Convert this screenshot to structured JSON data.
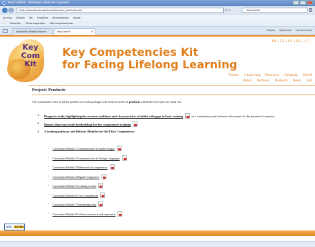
{
  "browser": {
    "window_title": "KeyComKit - Windows Internet Explorer",
    "url": "http://www.keycompetenceskit.eu/en_products.html",
    "search_value": "KeyComKit",
    "menu": [
      "Archivo",
      "Edición",
      "Ver",
      "Favoritos",
      "Herramientas",
      "Ayuda"
    ],
    "favorites_bar": [
      "Favoritos",
      "Sitios sugeridos",
      "Más complementos"
    ],
    "tabs": [
      {
        "label": "Foroductiv Metal Informe"
      },
      {
        "label": "KeyComKit"
      }
    ],
    "command_bar": [
      "Página",
      "Seguridad",
      "Herramientas"
    ]
  },
  "site": {
    "logo_line1": "Key",
    "logo_line2": "Com",
    "logo_line3": "Kit",
    "title_line1": "Key Competencies Kit",
    "title_line2": "for Facing Lifelong Learning",
    "languages": "EN | ES | DE | BG | LT |",
    "nav_primary": [
      "Project",
      "e-Learning",
      "Resource",
      "Contacts",
      "Site M"
    ],
    "nav_secondary": [
      "About",
      "Partners",
      "Products",
      "News",
      "Gall"
    ]
  },
  "page": {
    "title": "Project: Products",
    "intro_before": "The coordinated work of all the partners on work packages will result in series of ",
    "intro_bold": "products",
    "intro_after": " within the next ones are stand out:",
    "items": [
      {
        "num": "1.",
        "link": "Diagnosis study, highlighting the current conditions and characteristics of adults with gaps in basic training",
        "tail": ", as a consultancy and reference document for the partnered countries."
      },
      {
        "num": "2.",
        "link": "Report about successful methodology for key competences training",
        "tail": ""
      },
      {
        "num": "3.",
        "link": "",
        "tail": "A training pathway and Didactic Modules for the 8 Key Competences:"
      }
    ],
    "modules": [
      "Curriculum Module 1 Communication in mother tongue",
      "Curriculum Module 2 Communication in Foreign Languages",
      "Curriculum Module 3 Mathematical competences",
      "Curriculum Module 4 Digital Competence",
      "Curriculum Module 5 Learning to learn",
      "Curriculum Module 6 Civic competences",
      "Curriculum Module 7 Entrepreneurship",
      "Curriculum Module 8 Cultural awareness and expression"
    ],
    "badge_w3c": "W3C",
    "badge_valid": "XHTML 1.0"
  },
  "colors": {
    "accent_orange": "#e07f1c",
    "logo_purple": "#5a2a78"
  }
}
